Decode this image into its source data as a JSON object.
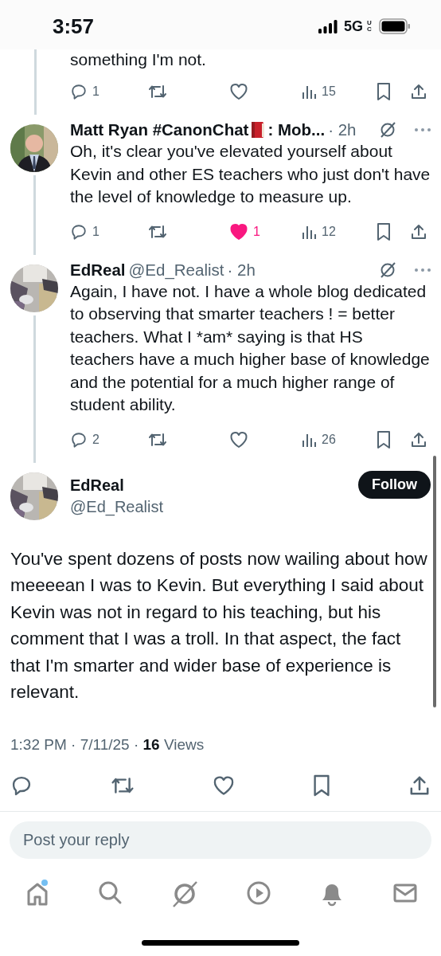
{
  "status_bar": {
    "time": "3:57",
    "network": "5G",
    "network_sub": "UC"
  },
  "thread": [
    {
      "kind": "fragment",
      "text": "something I'm not.",
      "actions": [
        {
          "kind": "reply",
          "count": "1"
        },
        {
          "kind": "repost"
        },
        {
          "kind": "like",
          "on": false
        },
        {
          "kind": "views",
          "count": "15"
        },
        {
          "kind": "bookmark"
        },
        {
          "kind": "share"
        }
      ]
    },
    {
      "kind": "reply",
      "name": "Matt Ryan #CanonChat",
      "name_badge": true,
      "name_suffix": ": Mob...",
      "time": "· 2h",
      "text": "Oh, it's clear you've elevated yourself about Kevin and other ES teachers who just don't have the level of knowledge to measure up.",
      "actions": [
        {
          "kind": "reply",
          "count": "1"
        },
        {
          "kind": "repost"
        },
        {
          "kind": "like",
          "on": true,
          "count": "1"
        },
        {
          "kind": "views",
          "count": "12"
        },
        {
          "kind": "bookmark"
        },
        {
          "kind": "share"
        }
      ]
    },
    {
      "kind": "reply",
      "name": "EdReal",
      "name_badge": false,
      "handle": "@Ed_Realist",
      "time": "· 2h",
      "text": "Again, I have not. I have a whole blog dedicated to observing that smarter teachers ! = better teachers. What I *am* saying is that HS teachers have a much higher base of knowledge and the potential for a much higher range of student ability.",
      "actions": [
        {
          "kind": "reply",
          "count": "2"
        },
        {
          "kind": "repost"
        },
        {
          "kind": "like",
          "on": false
        },
        {
          "kind": "views",
          "count": "26"
        },
        {
          "kind": "bookmark"
        },
        {
          "kind": "share"
        }
      ]
    }
  ],
  "post": {
    "name": "EdReal",
    "handle": "@Ed_Realist",
    "follow": "Follow",
    "text": "You've spent dozens of posts now wailing about how meeeean I was to Kevin. But everything I said about Kevin was not in regard to his teaching, but his comment  that I was a troll. In that aspect, the fact that I'm smarter and wider base of experience is relevant.",
    "meta": "1:32 PM · 7/11/25 · **16** Views",
    "actions": [
      {
        "kind": "reply"
      },
      {
        "kind": "repost"
      },
      {
        "kind": "like",
        "on": false
      },
      {
        "kind": "bookmark"
      },
      {
        "kind": "share"
      }
    ]
  },
  "reply_field": {
    "placeholder": "Post your reply"
  },
  "nav": [
    {
      "kind": "home",
      "badge": true
    },
    {
      "kind": "search",
      "badge": false
    },
    {
      "kind": "grok",
      "badge": false
    },
    {
      "kind": "video",
      "badge": false
    },
    {
      "kind": "bell",
      "badge": false
    },
    {
      "kind": "mail",
      "badge": false
    }
  ]
}
